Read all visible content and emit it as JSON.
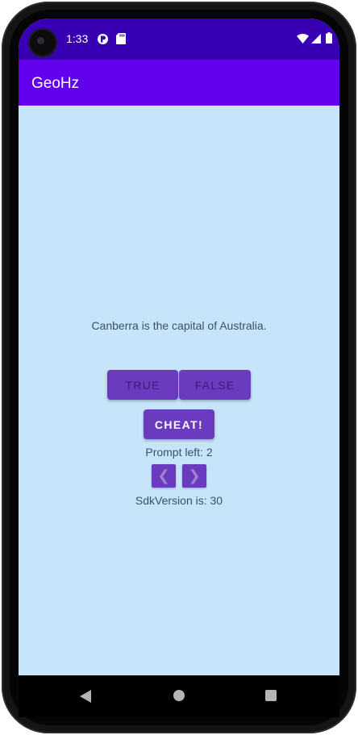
{
  "status_bar": {
    "time": "1:33",
    "left_icons": [
      "app-notification-icon",
      "sd-card-icon"
    ],
    "right_icons": [
      "wifi-icon",
      "cellular-signal-icon",
      "battery-icon"
    ]
  },
  "app_bar": {
    "title": "GeoHz"
  },
  "quiz": {
    "question": "Canberra is the capital of Australia.",
    "true_label": "TRUE",
    "false_label": "FALSE",
    "cheat_label": "CHEAT!",
    "prompt_left": "Prompt left: 2",
    "prev_glyph": "❮",
    "next_glyph": "❯",
    "sdk_version": "SdkVersion is: 30"
  },
  "navigation": {
    "buttons": [
      "back-icon",
      "home-icon",
      "recents-icon"
    ]
  },
  "colors": {
    "status_bar": "#3700b3",
    "app_bar": "#6200ee",
    "background": "#c6e4fa",
    "button": "#6a3abf"
  }
}
